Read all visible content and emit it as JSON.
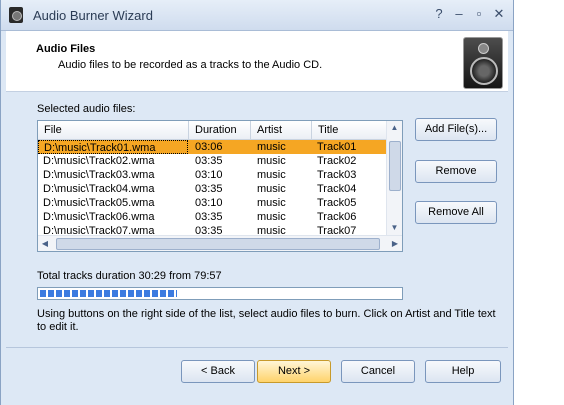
{
  "window": {
    "title": "Audio Burner Wizard"
  },
  "header": {
    "title": "Audio Files",
    "subtitle": "Audio files to be recorded as a tracks to the Audio CD."
  },
  "list": {
    "label": "Selected audio files:",
    "columns": [
      "File",
      "Duration",
      "Artist",
      "Title"
    ],
    "rows": [
      {
        "file": "D:\\music\\Track01.wma",
        "duration": "03:06",
        "artist": "music",
        "title": "Track01",
        "selected": true
      },
      {
        "file": "D:\\music\\Track02.wma",
        "duration": "03:35",
        "artist": "music",
        "title": "Track02"
      },
      {
        "file": "D:\\music\\Track03.wma",
        "duration": "03:10",
        "artist": "music",
        "title": "Track03"
      },
      {
        "file": "D:\\music\\Track04.wma",
        "duration": "03:35",
        "artist": "music",
        "title": "Track04"
      },
      {
        "file": "D:\\music\\Track05.wma",
        "duration": "03:10",
        "artist": "music",
        "title": "Track05"
      },
      {
        "file": "D:\\music\\Track06.wma",
        "duration": "03:35",
        "artist": "music",
        "title": "Track06"
      },
      {
        "file": "D:\\music\\Track07.wma",
        "duration": "03:35",
        "artist": "music",
        "title": "Track07"
      }
    ]
  },
  "side_buttons": {
    "add": "Add File(s)...",
    "remove": "Remove",
    "remove_all": "Remove All"
  },
  "duration": {
    "text": "Total tracks duration 30:29 from 79:57",
    "fraction": 0.381
  },
  "hint": "Using buttons on the right side of the list, select audio files to burn. Click on Artist and Title text to edit it.",
  "footer": {
    "back": "< Back",
    "next": "Next >",
    "cancel": "Cancel",
    "help": "Help"
  }
}
